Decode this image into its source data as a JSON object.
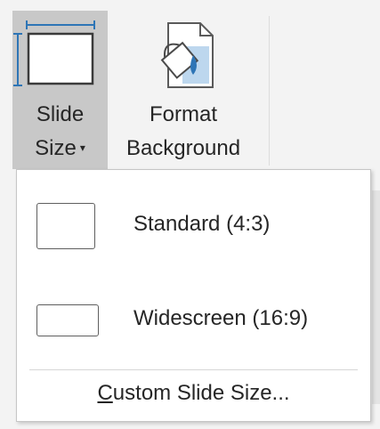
{
  "ribbon": {
    "slide_size": {
      "line1": "Slide",
      "line2": "Size",
      "caret": "▾"
    },
    "format_background": {
      "line1": "Format",
      "line2": "Background"
    }
  },
  "dropdown": {
    "options": [
      {
        "label": "Standard (4:3)"
      },
      {
        "label": "Widescreen (16:9)"
      }
    ],
    "custom": {
      "mnemonic": "C",
      "rest": "ustom Slide Size..."
    }
  },
  "colors": {
    "selected_button": "#c8c8c8",
    "icon_blue": "#2e75b6",
    "ribbon_bg": "#f3f3f3"
  },
  "icons": [
    "slide-size-icon",
    "format-background-icon",
    "caret-down-icon"
  ]
}
